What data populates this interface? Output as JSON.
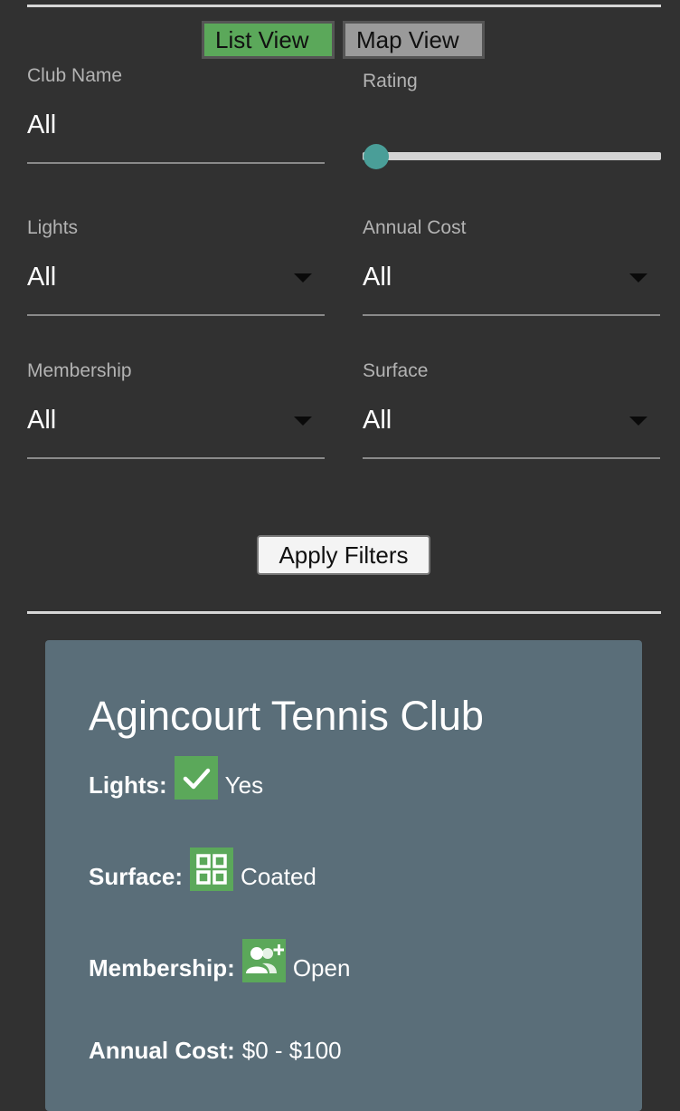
{
  "view_toggle": {
    "list_label": "List View",
    "map_label": "Map View",
    "active": "list"
  },
  "filters": {
    "club_name": {
      "label": "Club Name",
      "value": "All"
    },
    "rating": {
      "label": "Rating",
      "level": 0
    },
    "lights": {
      "label": "Lights",
      "value": "All"
    },
    "annual_cost": {
      "label": "Annual Cost",
      "value": "All"
    },
    "membership": {
      "label": "Membership",
      "value": "All"
    },
    "surface": {
      "label": "Surface",
      "value": "All"
    },
    "apply_label": "Apply Filters"
  },
  "club_card": {
    "name": "Agincourt Tennis Club",
    "lights": {
      "label": "Lights:",
      "value": "Yes",
      "icon": "checkmark-icon"
    },
    "surface": {
      "label": "Surface:",
      "value": "Coated",
      "icon": "grid-icon"
    },
    "membership": {
      "label": "Membership:",
      "value": "Open",
      "icon": "add-people-icon"
    },
    "annual_cost": {
      "label": "Annual Cost:",
      "value": "$0 - $100"
    }
  },
  "colors": {
    "background": "#313131",
    "accent": "#5ba85a",
    "card": "#5a6e79",
    "slider_thumb": "#4a9e98"
  }
}
